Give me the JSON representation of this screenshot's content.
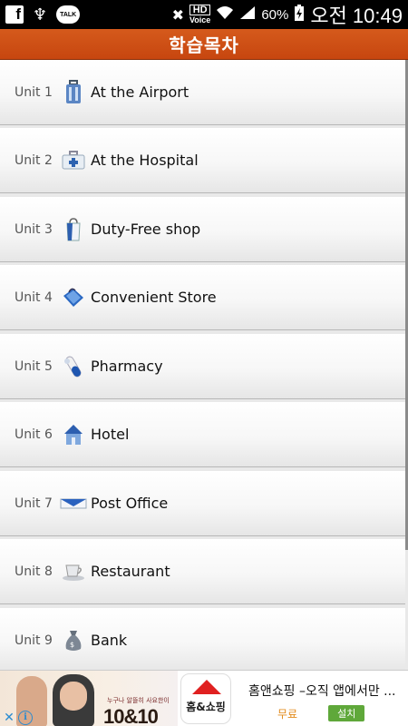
{
  "status_bar": {
    "facebook_letter": "f",
    "talk_label": "TALK",
    "hd_label": "HD",
    "voice_label": "Voice",
    "battery": "60%",
    "time": "오전 10:49"
  },
  "header": {
    "title": "학습목차",
    "color": "#cf4f16"
  },
  "units": [
    {
      "unit": "Unit 1",
      "title": "At the Airport",
      "icon": "suitcase-icon"
    },
    {
      "unit": "Unit 2",
      "title": "At the Hospital",
      "icon": "first-aid-icon"
    },
    {
      "unit": "Unit 3",
      "title": "Duty-Free shop",
      "icon": "shopping-bag-icon"
    },
    {
      "unit": "Unit 4",
      "title": "Convenient Store",
      "icon": "store-bag-icon"
    },
    {
      "unit": "Unit 5",
      "title": "Pharmacy",
      "icon": "pill-icon"
    },
    {
      "unit": "Unit 6",
      "title": "Hotel",
      "icon": "house-icon"
    },
    {
      "unit": "Unit 7",
      "title": "Post Office",
      "icon": "envelope-icon"
    },
    {
      "unit": "Unit 8",
      "title": "Restaurant",
      "icon": "coffee-cup-icon"
    },
    {
      "unit": "Unit 9",
      "title": "Bank",
      "icon": "money-bag-icon"
    }
  ],
  "ad": {
    "image_small_text": "누구나 알뜰히 사요한이",
    "image_big_text": "10&10",
    "logo_text": "홈&쇼핑",
    "title": "홈앤쇼핑 –오직 앱에서만 ...",
    "price_label": "무료",
    "install_label": "설치"
  }
}
